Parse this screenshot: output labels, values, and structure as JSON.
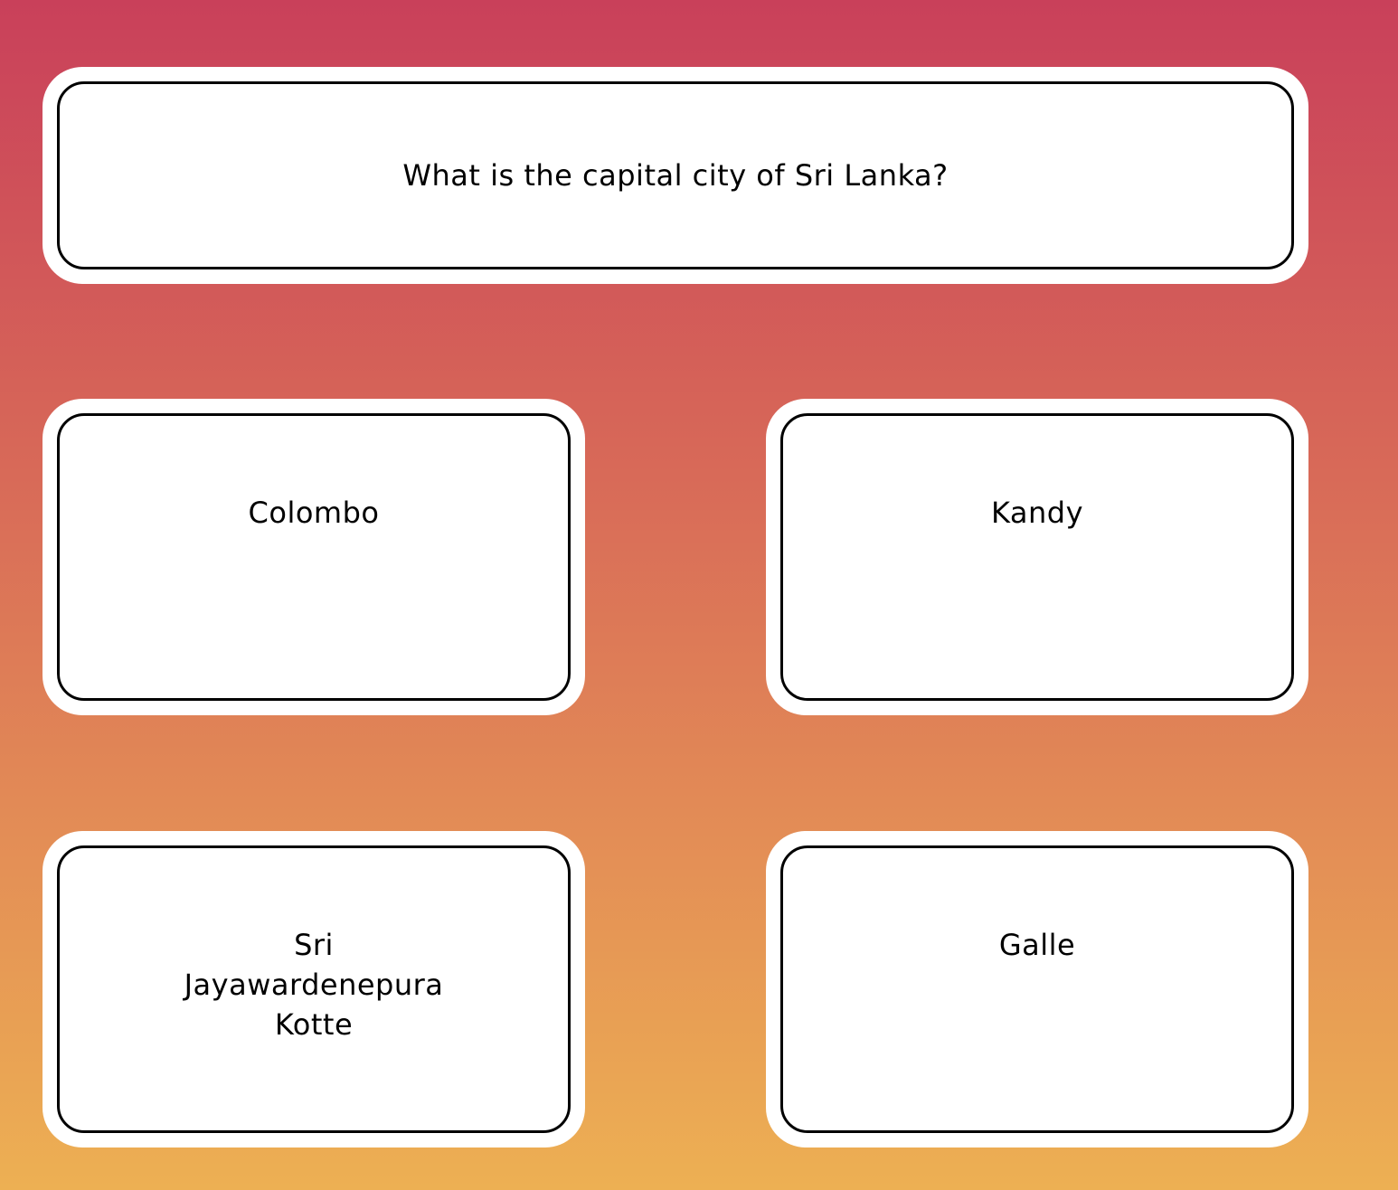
{
  "question": {
    "text": "What is the capital city of Sri Lanka?"
  },
  "answers": [
    {
      "label": "Colombo"
    },
    {
      "label": "Kandy"
    },
    {
      "label": "Sri Jayawardenepura Kotte"
    },
    {
      "label": "Galle"
    }
  ],
  "colors": {
    "background_top": "#c9405a",
    "background_bottom": "#edb053",
    "card_fill": "#ffffff",
    "card_border": "#000000",
    "text": "#000000"
  }
}
